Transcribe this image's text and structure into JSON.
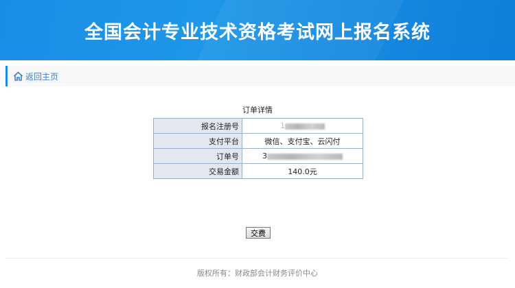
{
  "header": {
    "title": "全国会计专业技术资格考试网上报名系统"
  },
  "nav": {
    "back_label": "返回主页"
  },
  "order": {
    "caption": "订单详情",
    "rows": [
      {
        "label": "报名注册号",
        "value": "1"
      },
      {
        "label": "支付平台",
        "value": "微信、支付宝、云闪付"
      },
      {
        "label": "订单号",
        "value": "3"
      },
      {
        "label": "交易金额",
        "value": "140.0元"
      }
    ]
  },
  "actions": {
    "pay_label": "交费"
  },
  "footer": {
    "copyright": "版权所有：财政部会计财务评价中心"
  },
  "colors": {
    "accent": "#1e88e5",
    "header": "#1a8ee6",
    "label_bg": "#e3e8f0"
  }
}
